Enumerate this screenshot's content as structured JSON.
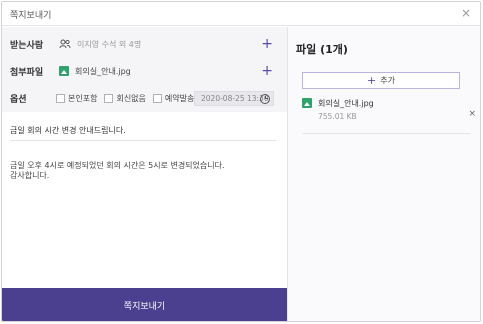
{
  "window": {
    "title": "쪽지보내기",
    "close_glyph": "×"
  },
  "form": {
    "recipients": {
      "label": "받는사람",
      "value": "이지영 수석 외 4명",
      "icon": "people-icon"
    },
    "attachment": {
      "label": "첨부파일",
      "value": "회의실_안내.jpg",
      "icon": "image-file-icon"
    },
    "options": {
      "label": "옵션",
      "items": [
        "본인포함",
        "회신없음",
        "예약발송"
      ],
      "datetime": "2020-08-25 13:30"
    },
    "plus_glyph": "+",
    "subject": "금일 회의 시간 변경 안내드립니다.",
    "body_line1": "금일 오후 4시로 예정되었던 회의 시간은 5시로 변경되었습니다.",
    "body_line2": "감사합니다."
  },
  "send_button": "쪽지보내기",
  "files_panel": {
    "title": "파일 (1개)",
    "add_plus": "+",
    "add_label": "추가",
    "files": [
      {
        "name": "회의실_안내.jpg",
        "size": "755.01 KB",
        "remove": "×"
      }
    ]
  },
  "colors": {
    "accent": "#4b3f8f",
    "file_icon": "#2fa36b"
  }
}
